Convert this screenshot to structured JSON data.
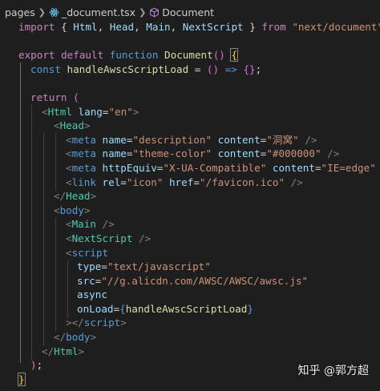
{
  "breadcrumb": {
    "folder": "pages",
    "file": "_document.tsx",
    "symbol": "Document"
  },
  "code": {
    "l1": [
      "import",
      " { ",
      "Html",
      ", ",
      "Head",
      ", ",
      "Main",
      ", ",
      "NextScript",
      " } ",
      "from",
      " ",
      "\"next/document\"",
      ";"
    ],
    "l3": [
      "export",
      " ",
      "default",
      " ",
      "function",
      " ",
      "Document",
      "(",
      ")",
      " ",
      "{"
    ],
    "l4": [
      "const",
      " ",
      "handleAwscScriptLoad",
      " = ",
      "(",
      ")",
      " => ",
      "{",
      "}",
      ";"
    ],
    "l6": [
      "return",
      " ",
      "("
    ],
    "l7": [
      "<",
      "Html",
      " ",
      "lang",
      "=",
      "\"en\"",
      ">"
    ],
    "l8": [
      "<",
      "Head",
      ">"
    ],
    "l9": [
      "<",
      "meta",
      " ",
      "name",
      "=",
      "\"description\"",
      " ",
      "content",
      "=",
      "\"洞窝\"",
      " />"
    ],
    "l10": [
      "<",
      "meta",
      " ",
      "name",
      "=",
      "\"theme-color\"",
      " ",
      "content",
      "=",
      "\"#000000\"",
      " />"
    ],
    "l11": [
      "<",
      "meta",
      " ",
      "httpEquiv",
      "=",
      "\"X-UA-Compatible\"",
      " ",
      "content",
      "=",
      "\"IE=edge\"",
      " />"
    ],
    "l12": [
      "<",
      "link",
      " ",
      "rel",
      "=",
      "\"icon\"",
      " ",
      "href",
      "=",
      "\"/favicon.ico\"",
      " />"
    ],
    "l13": [
      "</",
      "Head",
      ">"
    ],
    "l14": [
      "<",
      "body",
      ">"
    ],
    "l15": [
      "<",
      "Main",
      " />"
    ],
    "l16": [
      "<",
      "NextScript",
      " />"
    ],
    "l17": [
      "<",
      "script"
    ],
    "l18": [
      "type",
      "=",
      "\"text/javascript\""
    ],
    "l19": [
      "src",
      "=",
      "\"//g.alicdn.com/AWSC/AWSC/awsc.js\""
    ],
    "l20": [
      "async"
    ],
    "l21": [
      "onLoad",
      "=",
      "{",
      "handleAwscScriptLoad",
      "}"
    ],
    "l22": [
      "></",
      "script",
      ">"
    ],
    "l23": [
      "</",
      "body",
      ">"
    ],
    "l24": [
      "</",
      "Html",
      ">"
    ],
    "l25": [
      ")",
      ";"
    ],
    "l26": [
      "}"
    ]
  },
  "watermark": {
    "site": "知乎",
    "author": "@郭方超"
  },
  "colors": {
    "background": "#1e1e1e",
    "keyword": "#c586c0",
    "storage": "#569cd6",
    "variable": "#9cdcfe",
    "function": "#dcdcaa",
    "string": "#ce9178",
    "component": "#4ec9b0",
    "bracket_gold": "#ffd700",
    "bracket_orchid": "#da70d6",
    "bracket_blue": "#179fff"
  }
}
